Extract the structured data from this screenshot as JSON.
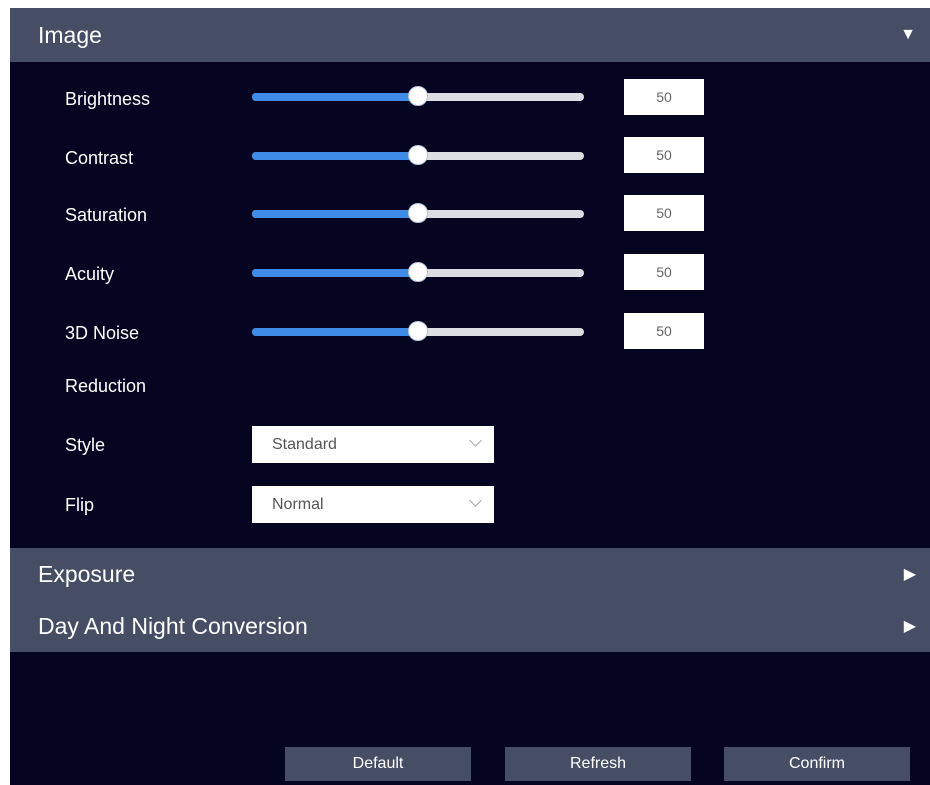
{
  "image_section": {
    "title": "Image",
    "expanded_icon": "triangle-down-icon",
    "sliders": [
      {
        "label": "Brightness",
        "value": "50",
        "level_percent": 50
      },
      {
        "label": "Contrast",
        "value": "50",
        "level_percent": 50
      },
      {
        "label": "Saturation",
        "value": "50",
        "level_percent": 50
      },
      {
        "label": "Acuity",
        "value": "50",
        "level_percent": 50
      },
      {
        "label": "3D Noise",
        "value": "50",
        "level_percent": 50
      }
    ],
    "reduction_label": "Reduction",
    "style": {
      "label": "Style",
      "value": "Standard"
    },
    "flip": {
      "label": "Flip",
      "value": "Normal"
    }
  },
  "exposure_section": {
    "title": "Exposure",
    "collapsed_icon": "triangle-right-icon"
  },
  "daynight_section": {
    "title": "Day And Night Conversion",
    "collapsed_icon": "triangle-right-icon"
  },
  "buttons": {
    "default": "Default",
    "refresh": "Refresh",
    "confirm": "Confirm"
  },
  "colors": {
    "background": "#050522",
    "header": "#454e65",
    "slider_fill": "#3f8ce8",
    "slider_track": "#dcdce3"
  }
}
